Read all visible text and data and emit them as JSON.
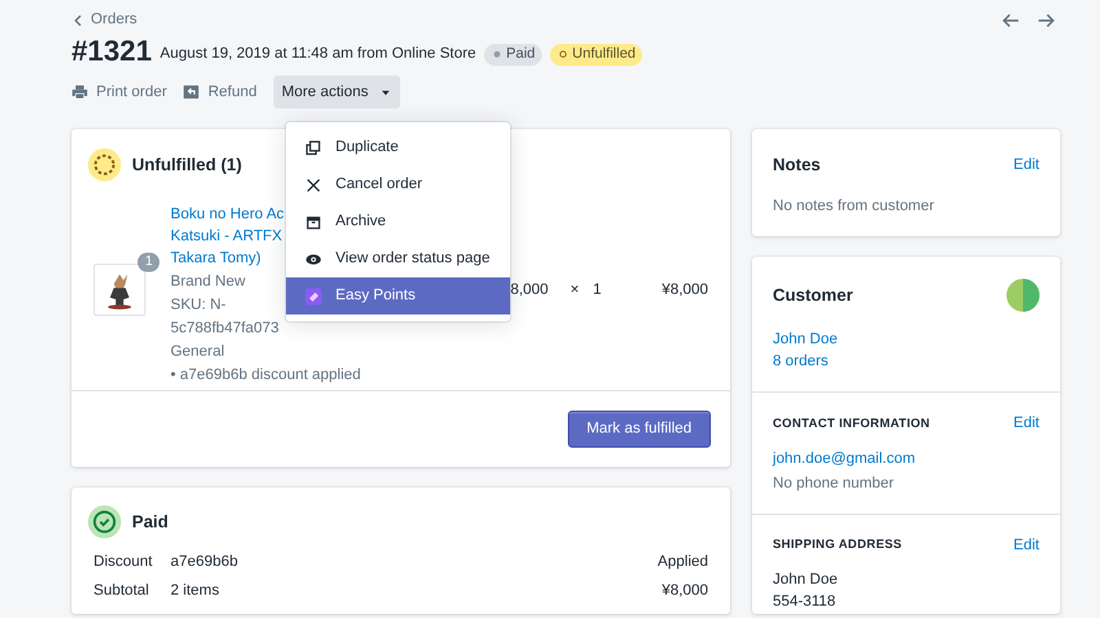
{
  "breadcrumb": "Orders",
  "order": {
    "number": "#1321",
    "meta": "August 19, 2019 at 11:48 am from Online Store",
    "badges": [
      {
        "label": "Paid",
        "kind": "paid"
      },
      {
        "label": "Unfulfilled",
        "kind": "unfulfilled"
      }
    ]
  },
  "actions": [
    {
      "label": "Print order",
      "kind": "print"
    },
    {
      "label": "Refund",
      "kind": "refund"
    },
    {
      "label": "More actions",
      "kind": "menu",
      "expanded": true
    }
  ],
  "menu": [
    {
      "label": "Duplicate",
      "kind": "duplicate",
      "selected": false
    },
    {
      "label": "Cancel order",
      "kind": "cancel",
      "selected": false
    },
    {
      "label": "Archive",
      "kind": "archive",
      "selected": false
    },
    {
      "label": "View order status page",
      "kind": "view",
      "selected": false
    },
    {
      "label": "Easy Points",
      "kind": "app",
      "selected": true
    }
  ],
  "unfulfilled": {
    "title": "Unfulfilled (1)",
    "item": {
      "quantity_badge": "1",
      "title_lines": [
        "Boku no Hero Ac",
        "Katsuki - ARTFX",
        "Takara Tomy)"
      ],
      "details": [
        "Brand New",
        "SKU: N-",
        "5c788fb47fa073",
        "General",
        "• a7e69b6b discount applied"
      ],
      "price": "8,000",
      "times": "×",
      "qty": "1",
      "total": "¥8,000"
    },
    "button": "Mark as fulfilled"
  },
  "paid": {
    "title": "Paid",
    "rows": [
      {
        "label": "Discount",
        "detail": "a7e69b6b",
        "value": "Applied"
      },
      {
        "label": "Subtotal",
        "detail": "2 items",
        "value": "¥8,000"
      }
    ]
  },
  "notes": {
    "title": "Notes",
    "edit": "Edit",
    "text": "No notes from customer"
  },
  "customer": {
    "title": "Customer",
    "name": "John Doe",
    "orders": "8 orders",
    "contact": {
      "heading": "CONTACT INFORMATION",
      "edit": "Edit",
      "email": "john.doe@gmail.com",
      "phone": "No phone number"
    },
    "shipping": {
      "heading": "SHIPPING ADDRESS",
      "edit": "Edit",
      "lines": [
        "John Doe",
        "554-3118"
      ]
    }
  }
}
